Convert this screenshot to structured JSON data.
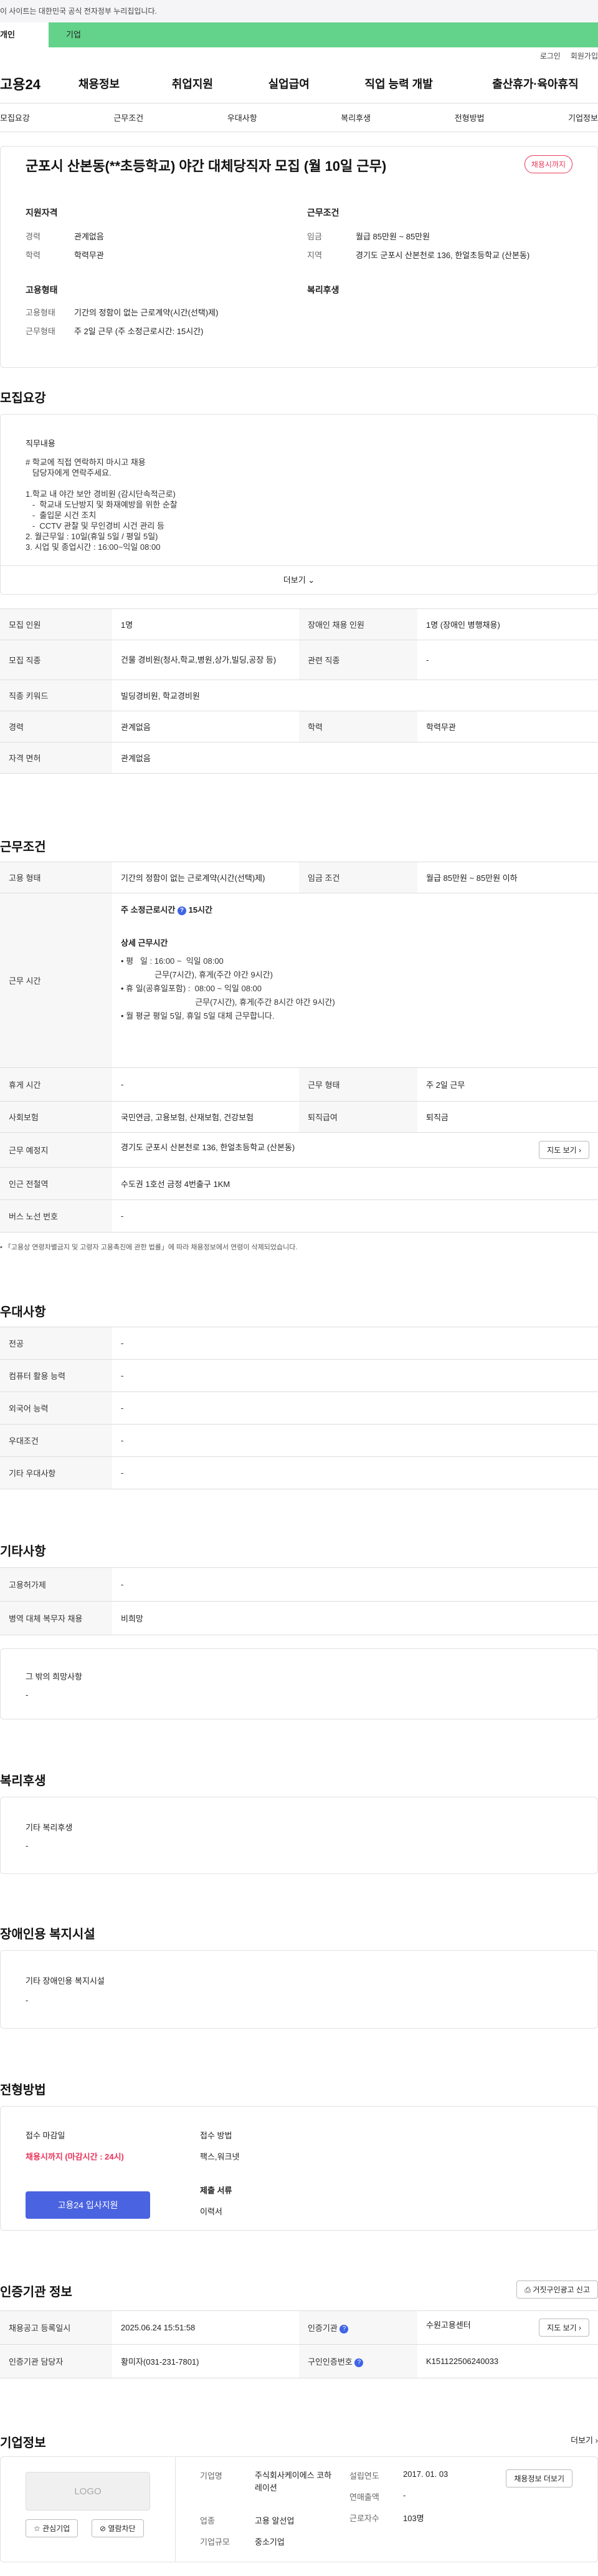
{
  "gov_banner": "이 사이트는 대한민국 공식 전자정부 누리집입니다.",
  "user_tabs": [
    "개인",
    "기업"
  ],
  "util": {
    "login": "로그인",
    "join": "회원가입"
  },
  "logo": "고용24",
  "gnb": [
    "채용정보",
    "취업지원",
    "실업급여",
    "직업 능력 개발",
    "출산휴가·육아휴직"
  ],
  "anchors": [
    "모집요강",
    "근무조건",
    "우대사항",
    "복리후생",
    "전형방법",
    "기업정보"
  ],
  "job": {
    "title": "군포시 산본동(**초등학교) 야간 대체당직자 모집 (월 10일 근무)",
    "status_badge": "채용시까지",
    "qual": {
      "title": "지원자격",
      "rows": [
        {
          "k": "경력",
          "v": "관계없음"
        },
        {
          "k": "학력",
          "v": "학력무관"
        }
      ]
    },
    "cond": {
      "title": "근무조건",
      "rows": [
        {
          "k": "임금",
          "v": "월급 85만원 ~ 85만원"
        },
        {
          "k": "지역",
          "v": "경기도 군포시 산본천로 136, 한얼초등학교 (산본동)"
        }
      ]
    },
    "emp": {
      "title": "고용형태",
      "rows": [
        {
          "k": "고용형태",
          "v": "기간의 정함이 없는 근로계약(시간(선택)제)"
        },
        {
          "k": "근무형태",
          "v": "주 2일 근무 (주 소정근로시간: 15시간)"
        }
      ]
    },
    "welfare": {
      "title": "복리후생"
    }
  },
  "recruit": {
    "title": "모집요강",
    "duty_label": "직무내용",
    "duty_text": "# 학교에 직접 연락하지 마시고 채용\n   담당자에게 연락주세요.\n\n1.학교 내 야간 보안 경비원 (감시단속적근로)\n   -  학교내 도난방지 및 화재예방을 위한 순찰\n   -  출입문 시건 조치\n   -  CCTV 관찰 및 무인경비 시건 관리 등\n2. 월근무일 : 10일(휴일 5일 / 평일 5일)\n3. 시업 및 종업시간 : 16:00~익일 08:00",
    "more": "더보기",
    "table": [
      {
        "k1": "모집 인원",
        "v1": "1명",
        "k2": "장애인 채용 인원",
        "v2": "1명 (장애인 병행채용)"
      },
      {
        "k1": "모집 직종",
        "v1": "건물 경비원(청사,학교,병원,상가,빌딩,공장 등)",
        "k2": "관련 직종",
        "v2": "-"
      },
      {
        "k1": "직종 키워드",
        "v1": "빌딩경비원, 학교경비원",
        "k2": "",
        "v2": ""
      },
      {
        "k1": "경력",
        "v1": "관계없음",
        "k2": "학력",
        "v2": "학력무관"
      },
      {
        "k1": "자격 면허",
        "v1": "관계없음",
        "k2": "",
        "v2": ""
      }
    ]
  },
  "work": {
    "title": "근무조건",
    "emp_type_k": "고용 형태",
    "emp_type_v": "기간의 정함이 없는 근로계약(시간(선택)제)",
    "wage_k": "임금 조건",
    "wage_v": "월급 85만원 ~ 85만원 이하",
    "hours_k": "근무 시간",
    "weekly_hours": "주 소정근로시간",
    "weekly_hours_val": "15시간",
    "detail_title": "상세 근무시간",
    "detail_text": "• 평   일 : 16:00 ~  익일 08:00\n               근무(7시간), 휴게(주간 야간 9시간)\n• 휴 일(공휴일포함) :  08:00 ~ 익일 08:00\n                                 근무(7시간), 휴게(주간 8시간 야간 9시간)\n• 월 평균 평일 5일, 휴일 5일 대체 근무합니다.",
    "rest_k": "휴게 시간",
    "rest_v": "-",
    "form_k": "근무 형태",
    "form_v": "주 2일 근무",
    "ins_k": "사회보험",
    "ins_v": "국민연금, 고용보험, 산재보험, 건강보험",
    "sev_k": "퇴직급여",
    "sev_v": "퇴직금",
    "place_k": "근무 예정지",
    "place_v": "경기도 군포시 산본천로 136, 한얼초등학교 (산본동)",
    "map_btn": "지도 보기",
    "subway_k": "인근 전철역",
    "subway_v": "수도권 1호선 금정 4번출구 1KM",
    "bus_k": "버스 노선 번호",
    "bus_v": "-",
    "notice": "「고용상 연령차별금지 및 고령자 고용촉진에 관한 법률」에 따라 채용정보에서 연령이 삭제되었습니다."
  },
  "pref": {
    "title": "우대사항",
    "rows": [
      {
        "k": "전공",
        "v": "-"
      },
      {
        "k": "컴퓨터 활용 능력",
        "v": "-"
      },
      {
        "k": "외국어 능력",
        "v": "-"
      },
      {
        "k": "우대조건",
        "v": "-"
      },
      {
        "k": "기타 우대사항",
        "v": "-"
      }
    ]
  },
  "etc": {
    "title": "기타사항",
    "rows": [
      {
        "k": "고용허가제",
        "v": "-"
      },
      {
        "k": "병역 대체 복무자 채용",
        "v": "비희망"
      }
    ],
    "hope_title": "그 밖의 희망사항",
    "hope_v": "-"
  },
  "benefit": {
    "title": "복리후생",
    "sub": "기타 복리후생",
    "v": "-"
  },
  "disabled": {
    "title": "장애인용 복지시설",
    "sub": "기타 장애인용 복지시설",
    "v": "-"
  },
  "process": {
    "title": "전형방법",
    "deadline_label": "접수 마감일",
    "deadline_v": "채용시까지 (마감시간 : 24시)",
    "apply_btn": "고용24 입사지원",
    "method_label": "접수 방법",
    "method_v": "팩스,워크넷",
    "docs_label": "제출 서류",
    "docs_v": "이력서"
  },
  "agency": {
    "title": "인증기관 정보",
    "report_btn": "거짓구인광고 신고",
    "rows": [
      {
        "k1": "채용공고 등록일시",
        "v1": "2025.06.24 15:51:58",
        "k2": "인증기관",
        "v2": "수원고용센터"
      },
      {
        "k1": "인증기관 담당자",
        "v1": "황미자(031-231-7801)",
        "k2": "구인인증번호",
        "v2": "K151122506240033"
      }
    ],
    "map_btn": "지도 보기"
  },
  "company": {
    "title": "기업정보",
    "more": "더보기",
    "logo_text": "LOGO",
    "fav_btn": "관심기업",
    "check_btn": "열람차단",
    "info": [
      {
        "k": "기업명",
        "v": "주식회사케이에스 코하레이션"
      },
      {
        "k": "업종",
        "v": "고용 알선업"
      },
      {
        "k": "기업규모",
        "v": "중소기업"
      }
    ],
    "info2": [
      {
        "k": "설립연도",
        "v": "2017. 01. 03"
      },
      {
        "k": "연매출액",
        "v": "-"
      },
      {
        "k": "근로자수",
        "v": "103명"
      }
    ],
    "jobs_btn": "채용정보 더보기"
  }
}
